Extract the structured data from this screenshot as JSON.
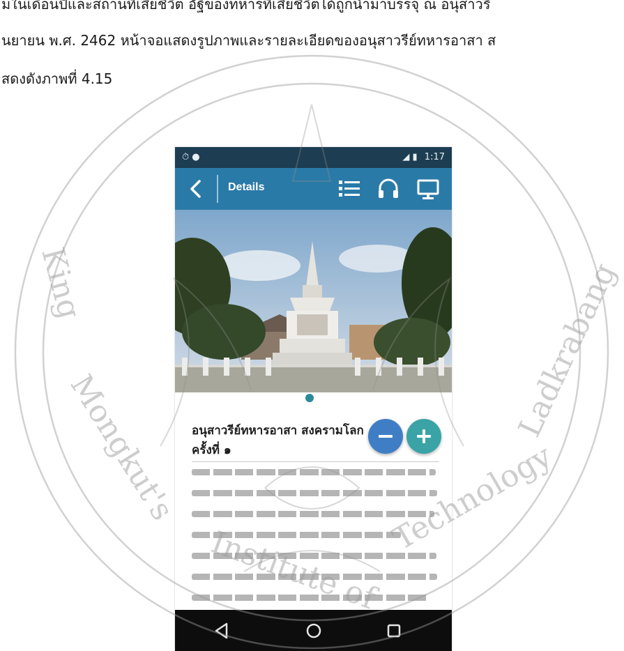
{
  "document": {
    "line1": "มในเดือนปีและสถานที่เสียชีวิต อัฐิของทหารที่เสียชีวิตได้ถูกนำมาบรรจุ ณ อนุสาวรี",
    "line2": "ันยายน พ.ศ. 2462 หน้าจอแสดงรูปภาพและรายละเอียดของอนุสาวรีย์ทหารอาสา ส",
    "line3": "สดงดังภาพที่ 4.15"
  },
  "watermark": {
    "text": "King Mongkut's Institute of Technology Ladkrabang"
  },
  "phone": {
    "status_bar": {
      "time": "1:17",
      "left_icons": [
        "alarm-icon",
        "notification-icon"
      ],
      "right_icons": [
        "signal-icon",
        "battery-icon"
      ]
    },
    "app_bar": {
      "title": "Details",
      "color": "#2a7aa8",
      "icons": [
        "back-arrow-icon",
        "list-icon",
        "headphones-icon",
        "monitor-icon"
      ]
    },
    "photo": {
      "subject": "monument-photo"
    },
    "content": {
      "title": "อนุสาวรีย์ทหารอาสา สงครามโลก ครั้งที่ ๑",
      "zoom_out_icon": "minus-icon",
      "zoom_in_icon": "plus-icon",
      "zoom_out_color": "#3f7ec4",
      "zoom_in_color": "#3aa3a6"
    },
    "nav_bar": {
      "icons": [
        "triangle-back-icon",
        "circle-home-icon",
        "square-recents-icon"
      ]
    }
  }
}
